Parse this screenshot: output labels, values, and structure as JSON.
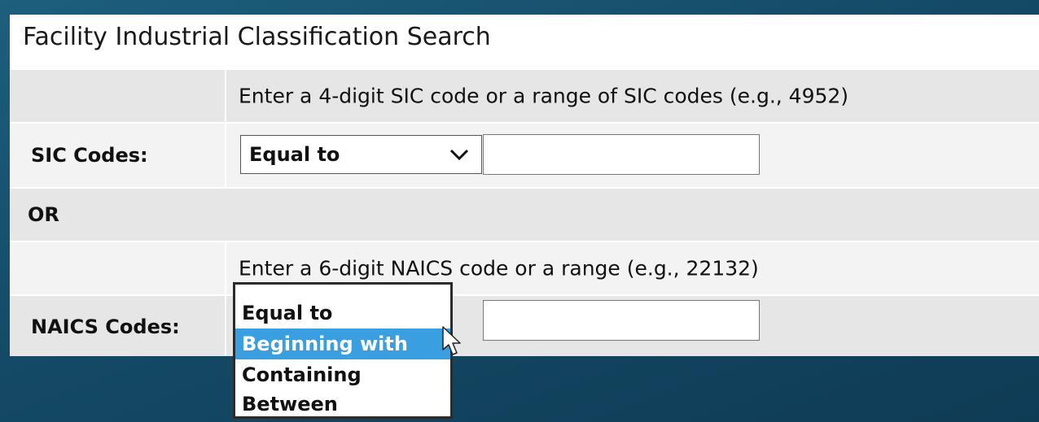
{
  "title": "Facility Industrial Classification Search",
  "sic": {
    "hint": "Enter a 4-digit SIC code or a range of SIC codes (e.g., 4952)",
    "label": "SIC Codes:",
    "operator": "Equal to",
    "value": ""
  },
  "or_label": "OR",
  "naics": {
    "hint": "Enter a 6-digit NAICS code or a range (e.g., 22132)",
    "label": "NAICS Codes:",
    "value": "",
    "options": [
      "Equal to",
      "Beginning with",
      "Containing",
      "Between"
    ],
    "highlighted": "Beginning with"
  },
  "colors": {
    "background": "#144a66",
    "row_shade": "#e6e6e6",
    "row_light": "#f3f3f3",
    "highlight": "#3a9fe0"
  }
}
